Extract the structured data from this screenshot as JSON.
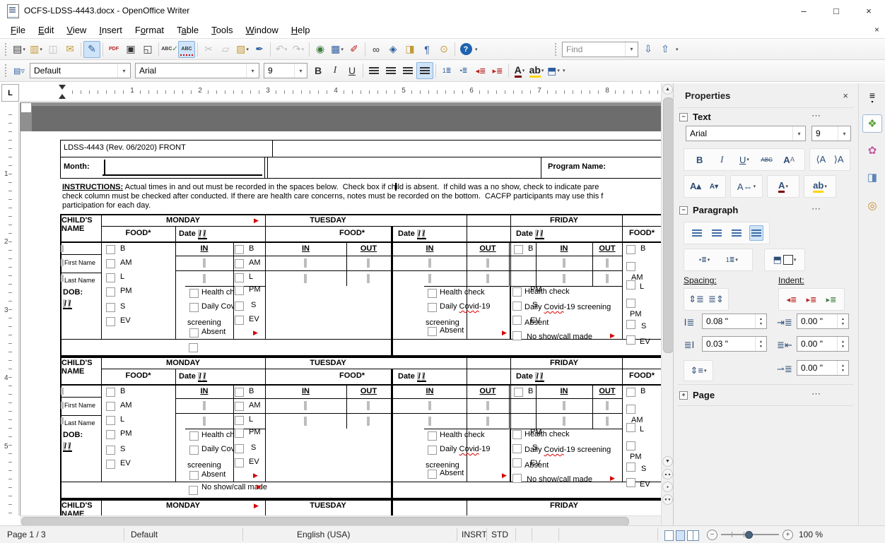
{
  "window": {
    "title": "OCFS-LDSS-4443.docx - OpenOffice Writer",
    "minimize": "–",
    "maximize": "□",
    "close": "×",
    "doc_close": "×"
  },
  "menu": {
    "items": [
      {
        "pre": "",
        "key": "F",
        "rest": "ile"
      },
      {
        "pre": "",
        "key": "E",
        "rest": "dit"
      },
      {
        "pre": "",
        "key": "V",
        "rest": "iew"
      },
      {
        "pre": "",
        "key": "I",
        "rest": "nsert"
      },
      {
        "pre": "F",
        "key": "o",
        "rest": "rmat"
      },
      {
        "pre": "T",
        "key": "a",
        "rest": "ble"
      },
      {
        "pre": "",
        "key": "T",
        "rest": "ools"
      },
      {
        "pre": "",
        "key": "W",
        "rest": "indow"
      },
      {
        "pre": "",
        "key": "H",
        "rest": "elp"
      }
    ]
  },
  "ui": {
    "dropdown": "▾",
    "combo_arrow": "▾",
    "spin_up": "▲",
    "spin_down": "▼",
    "flag": "▶",
    "more": "⋯",
    "collapse": "−",
    "expand": "+",
    "hamburger": "≡",
    "up": "▲",
    "down": "▼",
    "dbl_up": "▲▲",
    "dbl_down": "▼▼",
    "dot": "●"
  },
  "toolbar": {
    "glyphs": {
      "new": "▤",
      "open": "▥",
      "save": "◫",
      "email": "✉",
      "edit": "✎",
      "pdf": "PDF",
      "print": "▣",
      "preview": "◱",
      "spell": "ABC",
      "autospell": "ABC",
      "cut": "✂",
      "copy": "▱",
      "paste": "▧",
      "brush": "✒",
      "undo": "↶",
      "redo": "↷",
      "hyperlink": "◉",
      "table": "▦",
      "draw": "✐",
      "find_replace": "∞",
      "navigator": "◈",
      "gallery": "◨",
      "marks": "¶",
      "zoom": "⊙",
      "help": "?"
    },
    "find": {
      "placeholder": "Find",
      "next": "⇩",
      "prev": "⇧"
    },
    "formatting": {
      "style": "Default",
      "font": "Arial",
      "size": "9",
      "bold": "B",
      "italic": "I",
      "underline": "U",
      "fontcolor": "A",
      "highlight": "ab"
    }
  },
  "ruler": {
    "h": [
      "1",
      "2",
      "3",
      "4",
      "5",
      "6",
      "7",
      "8"
    ],
    "v": [
      "1",
      "2",
      "3",
      "4",
      "5"
    ]
  },
  "document": {
    "form_id": "LDSS-4443 (Rev. 06/2020) FRONT",
    "month": "Month:",
    "program": "Program Name:",
    "instr_label": "INSTRUCTIONS:",
    "instr_1a": " Actual times in and out must be recorded in the spaces below.  ",
    "instr_1b": "Check box if child is absent.  If child was a no show, check to indicate pare",
    "instr_2": "check column must be checked after conducted. If there are health care concerns, notes must be recorded on the bottom.  CACFP participants may use this f",
    "instr_3": "participation for each day.",
    "childs_name": "CHILD'S NAME",
    "monday": "MONDAY",
    "tuesday": "TUESDAY",
    "friday": "FRIDAY",
    "food": "FOOD*",
    "date": "Date",
    "slashes": "/ /",
    "in": "IN",
    "out": "OUT",
    "first_name": "First Name",
    "last_name": "Last Name",
    "dob": "DOB:",
    "dob_slashes": "/ /",
    "b": "B",
    "am": "AM",
    "l": "L",
    "pm": "PM",
    "s": "S",
    "ev": "EV",
    "health": "Health check",
    "covid_daily": "Daily ",
    "covid_word": "Covid",
    "covid_suffix": "-19",
    "covid_suffix_screening": "-19 screening",
    "screening": "screening",
    "absent": "Absent",
    "no_show": "No show/call made"
  },
  "sidebar": {
    "title": "Properties",
    "text": {
      "label": "Text",
      "font": "Arial",
      "size": "9",
      "bold": "B",
      "italic": "I",
      "underline": "U",
      "strike": "ABC",
      "aa": "A"
    },
    "paragraph": {
      "label": "Paragraph",
      "spacing_label": "Spacing:",
      "indent_label": "Indent:",
      "above": "0.08 \"",
      "below": "0.03 \"",
      "before": "0.00 \"",
      "after": "0.00 \"",
      "first_line": "0.00 \""
    },
    "page": {
      "label": "Page"
    }
  },
  "statusbar": {
    "page": "Page 1 / 3",
    "style": "Default",
    "language": "English (USA)",
    "insert": "INSRT",
    "selection": "STD",
    "zoom": "100 %"
  }
}
